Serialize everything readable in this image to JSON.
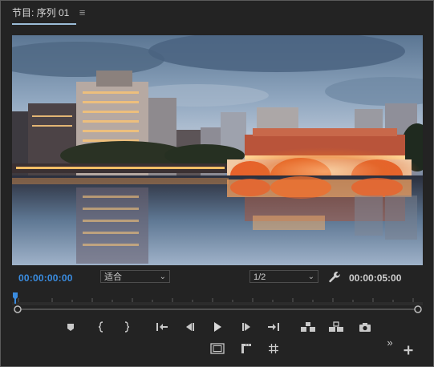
{
  "header": {
    "tab_title": "节目: 序列 01",
    "menu_icon": "hamburger-menu-icon"
  },
  "controls": {
    "current_timecode": "00:00:00:00",
    "zoom_select": {
      "value": "适合"
    },
    "resolution_select": {
      "value": "1/2"
    },
    "duration_timecode": "00:00:05:00"
  },
  "transport": {
    "buttons": [
      "add-marker-icon",
      "mark-in-icon",
      "mark-out-icon",
      "go-to-in-icon",
      "step-back-icon",
      "play-icon",
      "step-forward-icon",
      "go-to-out-icon",
      "lift-icon",
      "extract-icon",
      "export-frame-icon"
    ],
    "secondary": [
      "safe-margins-icon",
      "proxy-toggle-icon",
      "grid-icon",
      "more-icon",
      "add-button-icon"
    ]
  },
  "colors": {
    "accent_blue": "#3a8ce0",
    "panel_bg": "#232323",
    "header_underline": "#9bbcd7"
  }
}
